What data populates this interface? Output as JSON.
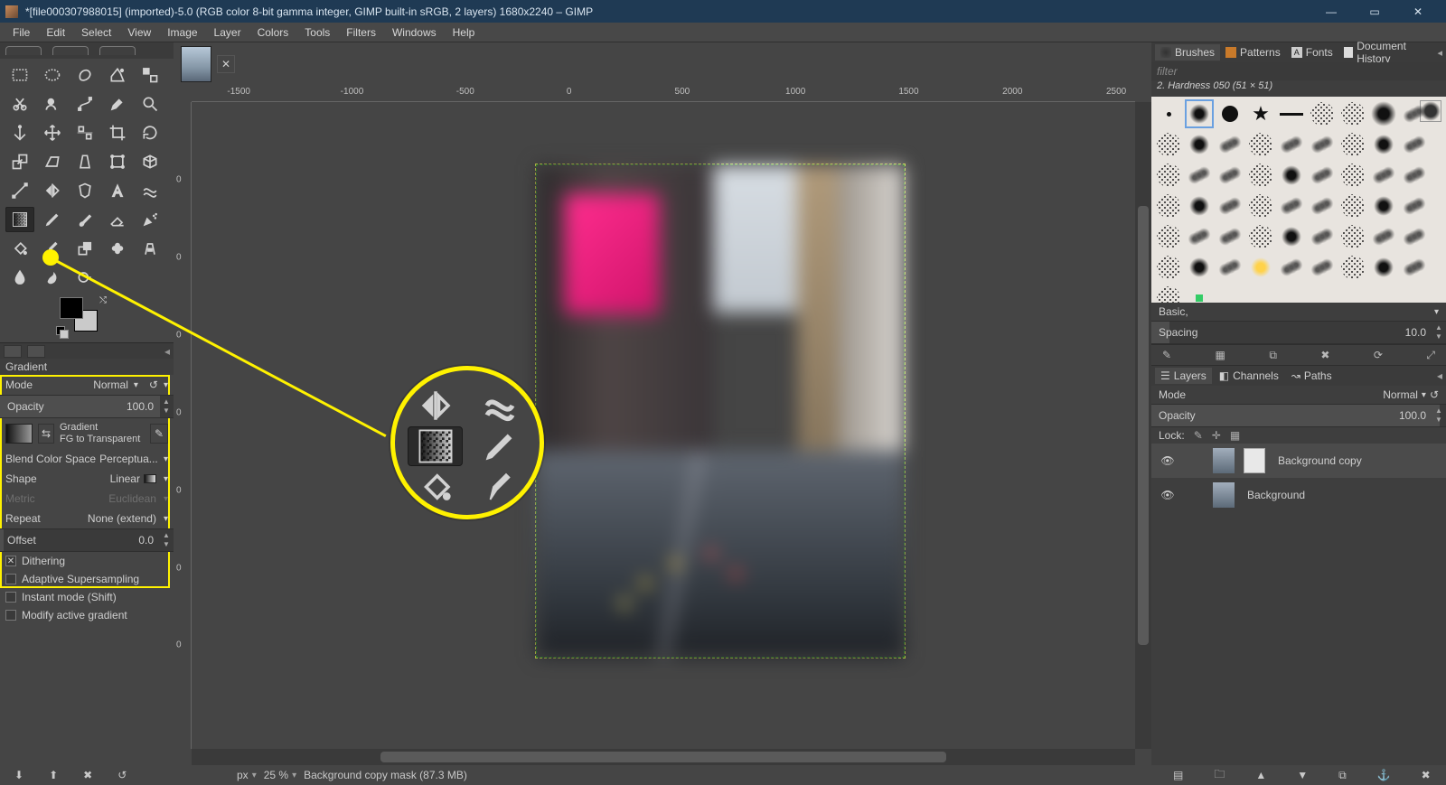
{
  "window": {
    "title": "*[file000307988015] (imported)-5.0 (RGB color 8-bit gamma integer, GIMP built-in sRGB, 2 layers) 1680x2240 – GIMP"
  },
  "menu": [
    "File",
    "Edit",
    "Select",
    "View",
    "Image",
    "Layer",
    "Colors",
    "Tools",
    "Filters",
    "Windows",
    "Help"
  ],
  "tool_options": {
    "title": "Gradient",
    "mode_label": "Mode",
    "mode_value": "Normal",
    "opacity_label": "Opacity",
    "opacity_value": "100.0",
    "gradient_label": "Gradient",
    "gradient_name": "FG to Transparent",
    "blend_label": "Blend Color Space",
    "blend_value": "Perceptua...",
    "shape_label": "Shape",
    "shape_value": "Linear",
    "metric_label": "Metric",
    "metric_value": "Euclidean",
    "repeat_label": "Repeat",
    "repeat_value": "None (extend)",
    "offset_label": "Offset",
    "offset_value": "0.0",
    "dithering_label": "Dithering",
    "adaptive_label": "Adaptive Supersampling",
    "instant_label": "Instant mode  (Shift)",
    "modify_label": "Modify active gradient"
  },
  "ruler_h": [
    "-1500",
    "-1000",
    "-500",
    "0",
    "500",
    "1000",
    "1500",
    "2000",
    "2500"
  ],
  "ruler_v": [
    "0",
    "0",
    "0",
    "0",
    "0",
    "0",
    "0"
  ],
  "status": {
    "unit": "px",
    "zoom": "25 %",
    "msg": "Background copy mask (87.3 MB)"
  },
  "right": {
    "tabs": [
      "Brushes",
      "Patterns",
      "Fonts",
      "Document History"
    ],
    "filter_placeholder": "filter",
    "brush_title": "2. Hardness 050 (51 × 51)",
    "preset_label": "Basic,",
    "spacing_label": "Spacing",
    "spacing_value": "10.0",
    "layer_tabs": [
      "Layers",
      "Channels",
      "Paths"
    ],
    "mode_label": "Mode",
    "mode_value": "Normal",
    "opacity_label": "Opacity",
    "opacity_value": "100.0",
    "lock_label": "Lock:",
    "layers": [
      {
        "name": "Background copy"
      },
      {
        "name": "Background"
      }
    ]
  }
}
